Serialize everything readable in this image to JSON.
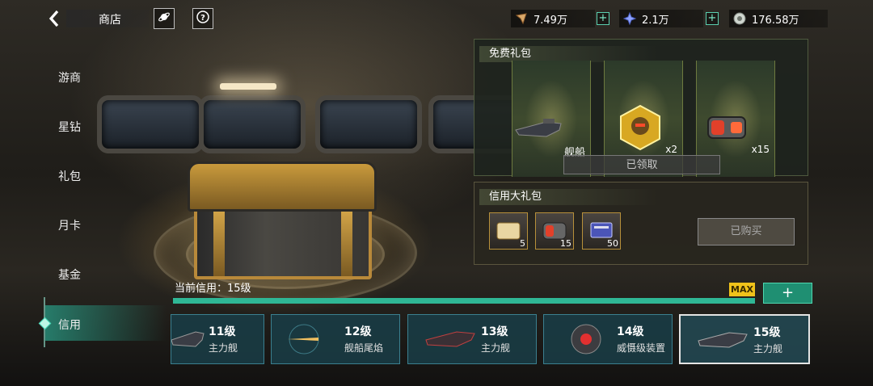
{
  "header": {
    "title": "商店"
  },
  "resources": [
    {
      "icon": "fuel-crystal-icon",
      "value": "7.49万",
      "addable": true
    },
    {
      "icon": "star-diamond-icon",
      "value": "2.1万",
      "addable": true
    },
    {
      "icon": "credit-coin-icon",
      "value": "176.58万",
      "addable": false
    }
  ],
  "sidebar": {
    "items": [
      {
        "label": "游商"
      },
      {
        "label": "星钻"
      },
      {
        "label": "礼包"
      },
      {
        "label": "月卡"
      },
      {
        "label": "基金"
      },
      {
        "label": "信用"
      }
    ],
    "active": "信用"
  },
  "free_gift": {
    "title": "免费礼包",
    "items": [
      {
        "label": "舰船",
        "qty": ""
      },
      {
        "label": "",
        "qty": "x2"
      },
      {
        "label": "",
        "qty": "x15"
      }
    ],
    "status_label": "已领取"
  },
  "credit_pack": {
    "title": "信用大礼包",
    "items": [
      {
        "qty": "5"
      },
      {
        "qty": "15"
      },
      {
        "qty": "50"
      }
    ],
    "status_label": "已购买"
  },
  "credit_level": {
    "label": "当前信用：15级",
    "max_label": "MAX",
    "progress": 1.0,
    "upgrade_symbol": "+"
  },
  "rewards": [
    {
      "level": "11级",
      "name": "主力舰"
    },
    {
      "level": "12级",
      "name": "舰船尾焰"
    },
    {
      "level": "13级",
      "name": "主力舰"
    },
    {
      "level": "14级",
      "name": "威慑级装置"
    },
    {
      "level": "15级",
      "name": "主力舰",
      "selected": true
    }
  ],
  "colors": {
    "accent": "#2fb795",
    "max_badge": "#f0c21a",
    "gold": "#c99a3c"
  }
}
